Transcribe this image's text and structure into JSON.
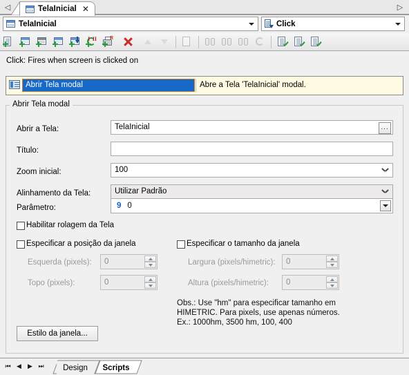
{
  "window": {
    "tab": {
      "title": "TelaInicial",
      "close_label": "✕",
      "icon": "window-icon"
    },
    "scroll_left": "◁",
    "scroll_right": "▷"
  },
  "combobar": {
    "object_value": "TelaInicial",
    "object_icon": "window-icon",
    "event_value": "Click",
    "event_icon": "script-event-icon"
  },
  "toolbar": {
    "buttons": [
      {
        "name": "new-script-action-icon",
        "enabled": true
      },
      {
        "name": "new-screen-action-icon",
        "enabled": true
      },
      {
        "name": "new-image-action-icon",
        "enabled": true
      },
      {
        "name": "new-window-action-icon",
        "enabled": true
      },
      {
        "name": "download-action-icon",
        "enabled": true
      },
      {
        "name": "loop-action-icon",
        "enabled": true
      },
      {
        "name": "print-action-icon",
        "enabled": true
      },
      {
        "name": "delete-action-icon",
        "enabled": true
      },
      {
        "name": "move-up-icon",
        "enabled": false
      },
      {
        "name": "move-down-icon",
        "enabled": false
      },
      {
        "name": "edit-properties-icon",
        "enabled": false
      },
      {
        "name": "find-icon",
        "enabled": false
      },
      {
        "name": "find-next-icon",
        "enabled": false
      },
      {
        "name": "find-previous-icon",
        "enabled": false
      },
      {
        "name": "refresh-icon",
        "enabled": false
      },
      {
        "name": "script-check-1-icon",
        "enabled": true
      },
      {
        "name": "script-check-2-icon",
        "enabled": true
      },
      {
        "name": "script-check-3-icon",
        "enabled": true
      }
    ]
  },
  "hint": {
    "text": "Click: Fires when screen is clicked on"
  },
  "action_list": {
    "selected_action": "Abrir Tela modal",
    "description": "Abre a Tela 'TelaInicial' modal.",
    "icon": "open-modal-screen-icon"
  },
  "group": {
    "title": "Abrir Tela modal"
  },
  "fields": {
    "screen": {
      "label": "Abrir a Tela:",
      "value": "TelaInicial",
      "browse_label": "..."
    },
    "title": {
      "label": "Título:",
      "value": "",
      "placeholder": ""
    },
    "zoom": {
      "label": "Zoom inicial:",
      "value": "100"
    },
    "alignment": {
      "label": "Alinhamento da Tela:",
      "value": "Utilizar Padrão"
    },
    "parameter": {
      "label": "Parâmetro:",
      "prefix": "9",
      "value": "0"
    }
  },
  "checkboxes": {
    "scroll": {
      "label": "Habilitar rolagem da Tela",
      "checked": false
    },
    "position": {
      "label": "Especificar a posição da janela",
      "checked": false
    },
    "size": {
      "label": "Especificar o tamanho da janela",
      "checked": false
    }
  },
  "spinners": {
    "left": {
      "label": "Esquerda (pixels):",
      "value": "0"
    },
    "top": {
      "label": "Topo (pixels):",
      "value": "0"
    },
    "width": {
      "label": "Largura (pixels/himetric):",
      "value": "0"
    },
    "height": {
      "label": "Altura (pixels/himetric):",
      "value": "0"
    }
  },
  "note": {
    "text": "Obs.: Use \"hm\" para especificar tamanho em\nHIMETRIC. Para pixels, use apenas números.\nEx.: 1000hm, 3500 hm, 100, 400"
  },
  "buttons": {
    "window_style": "Estilo da janela..."
  },
  "bottom": {
    "nav": {
      "first": "⏮",
      "prev": "◀",
      "next": "▶",
      "last": "⏭"
    },
    "tabs": [
      {
        "label": "Design",
        "active": false
      },
      {
        "label": "Scripts",
        "active": true
      }
    ]
  },
  "colors": {
    "accent_selection": "#1669c8",
    "selection_border": "#d07a2c",
    "info_background": "#fffbe2",
    "parameter_key": "#1a5fd0",
    "delete_red": "#cc2b2b",
    "add_green": "#2e9b3e"
  }
}
